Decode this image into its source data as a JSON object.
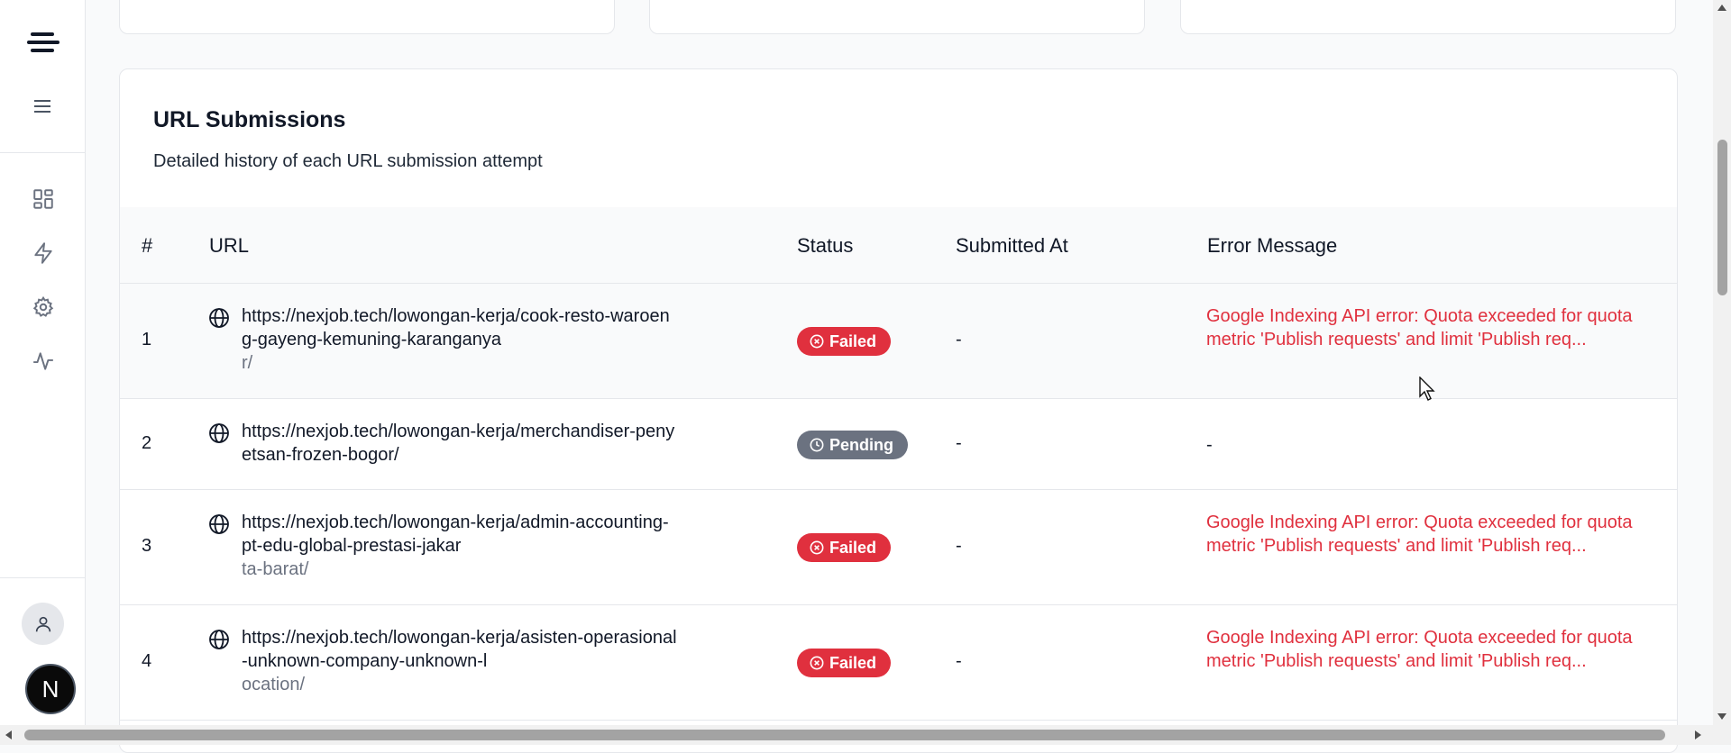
{
  "sidebar": {
    "nav": [
      {
        "icon": "dashboard-icon"
      },
      {
        "icon": "lightning-icon"
      },
      {
        "icon": "gear-icon"
      },
      {
        "icon": "activity-icon"
      }
    ],
    "user_icon": "user-icon",
    "next_badge": "N"
  },
  "card": {
    "title": "URL Submissions",
    "subtitle": "Detailed history of each URL submission attempt"
  },
  "table": {
    "headers": {
      "num": "#",
      "url": "URL",
      "status": "Status",
      "submitted": "Submitted At",
      "error": "Error Message"
    },
    "rows": [
      {
        "num": "1",
        "url_l1": "https://nexjob.tech/lowongan-kerja/cook-resto-waroen",
        "url_l2": "g-gayeng-kemuning-karanganya",
        "url_l3": "r/",
        "status": "Failed",
        "submitted": "-",
        "error": "Google Indexing API error: Quota exceeded for quota metric 'Publish requests' and limit 'Publish req..."
      },
      {
        "num": "2",
        "url_l1": "https://nexjob.tech/lowongan-kerja/merchandiser-peny",
        "url_l2": "etsan-frozen-bogor/",
        "url_l3": "",
        "status": "Pending",
        "submitted": "-",
        "error": "-"
      },
      {
        "num": "3",
        "url_l1": "https://nexjob.tech/lowongan-kerja/admin-accounting-",
        "url_l2": "pt-edu-global-prestasi-jakar",
        "url_l3": "ta-barat/",
        "status": "Failed",
        "submitted": "-",
        "error": "Google Indexing API error: Quota exceeded for quota metric 'Publish requests' and limit 'Publish req..."
      },
      {
        "num": "4",
        "url_l1": "https://nexjob.tech/lowongan-kerja/asisten-operasional",
        "url_l2": "-unknown-company-unknown-l",
        "url_l3": "ocation/",
        "status": "Failed",
        "submitted": "-",
        "error": "Google Indexing API error: Quota exceeded for quota metric 'Publish requests' and limit 'Publish req..."
      }
    ]
  },
  "colors": {
    "failed": "#e0303e",
    "pending": "#6b7280",
    "error_text": "#e0303e"
  }
}
